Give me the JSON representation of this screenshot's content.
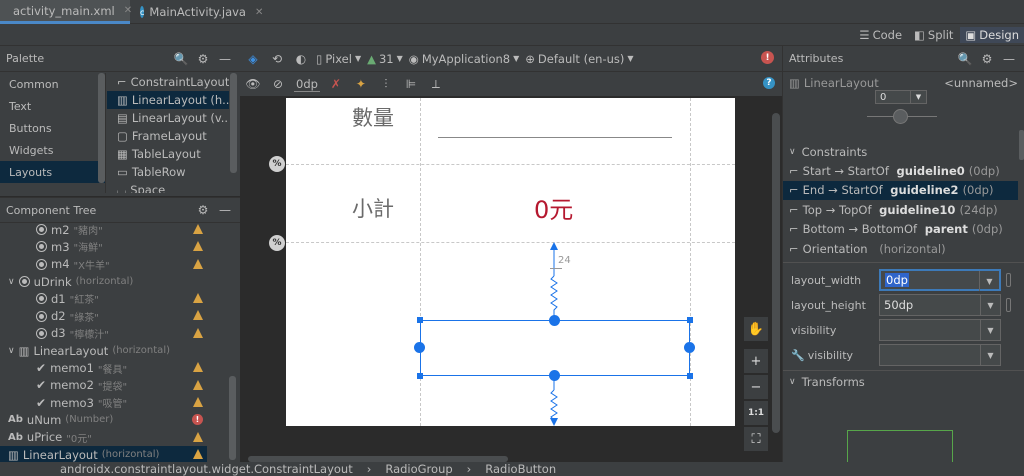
{
  "tabs": [
    {
      "label": "activity_main.xml",
      "active": true
    },
    {
      "label": "MainActivity.java",
      "active": false
    }
  ],
  "mode_buttons": {
    "code": "Code",
    "split": "Split",
    "design": "Design"
  },
  "palette": {
    "title": "Palette",
    "categories": [
      "Common",
      "Text",
      "Buttons",
      "Widgets",
      "Layouts"
    ],
    "selected_category": "Layouts",
    "items": [
      "ConstraintLayout",
      "LinearLayout (h...",
      "LinearLayout (v...",
      "FrameLayout",
      "TableLayout",
      "TableRow",
      "Space"
    ]
  },
  "toolbar": {
    "device": "Pixel",
    "api": "31",
    "app": "MyApplication8",
    "locale": "Default (en-us)",
    "margin": "0dp"
  },
  "component_tree": {
    "title": "Component Tree",
    "rows": [
      {
        "icon": "radio",
        "name": "m2",
        "sub": "\"豬肉\"",
        "indent": 1,
        "status": "warn"
      },
      {
        "icon": "radio",
        "name": "m3",
        "sub": "\"海鮮\"",
        "indent": 1,
        "status": "warn"
      },
      {
        "icon": "radio",
        "name": "m4",
        "sub": "\"X牛羊\"",
        "indent": 1,
        "status": "warn"
      },
      {
        "icon": "radio",
        "name": "uDrink",
        "sub": "(horizontal)",
        "indent": 0,
        "caret": "v",
        "status": ""
      },
      {
        "icon": "radio",
        "name": "d1",
        "sub": "\"紅茶\"",
        "indent": 1,
        "status": "warn"
      },
      {
        "icon": "radio",
        "name": "d2",
        "sub": "\"綠茶\"",
        "indent": 1,
        "status": "warn"
      },
      {
        "icon": "radio",
        "name": "d3",
        "sub": "\"檸檬汁\"",
        "indent": 1,
        "status": "warn"
      },
      {
        "icon": "layout",
        "name": "LinearLayout",
        "sub": "(horizontal)",
        "indent": 0,
        "caret": "v",
        "status": ""
      },
      {
        "icon": "check",
        "name": "memo1",
        "sub": "\"餐具\"",
        "indent": 1,
        "status": "warn"
      },
      {
        "icon": "check",
        "name": "memo2",
        "sub": "\"提袋\"",
        "indent": 1,
        "status": "warn"
      },
      {
        "icon": "check",
        "name": "memo3",
        "sub": "\"吸管\"",
        "indent": 1,
        "status": "warn"
      },
      {
        "icon": "ab",
        "name": "uNum",
        "sub": "(Number)",
        "indent": 0,
        "status": "err"
      },
      {
        "icon": "ab",
        "name": "uPrice",
        "sub": "\"0元\"",
        "indent": 0,
        "status": "warn"
      },
      {
        "icon": "layout",
        "name": "LinearLayout",
        "sub": "(horizontal)",
        "indent": 0,
        "status": "warn",
        "selected": true
      }
    ]
  },
  "design": {
    "qty_label": "數量",
    "subtotal_label": "小計",
    "subtotal_value": "0元",
    "margin_badge": "24",
    "guideline_badge": "%"
  },
  "attributes": {
    "title": "Attributes",
    "component": "LinearLayout",
    "id": "<unnamed>",
    "spinner_value": "0",
    "constraints_title": "Constraints",
    "constraints": [
      {
        "text": "Start → StartOf ",
        "bold": "guideline0",
        "extra": " (0dp)"
      },
      {
        "text": "End → StartOf ",
        "bold": "guideline2",
        "extra": " (0dp)",
        "selected": true
      },
      {
        "text": "Top → TopOf ",
        "bold": "guideline10",
        "extra": " (24dp)"
      },
      {
        "text": "Bottom → BottomOf ",
        "bold": "parent",
        "extra": " (0dp)"
      },
      {
        "text": "Orientation ",
        "bold": "",
        "extra": " (horizontal)"
      }
    ],
    "layout_width_label": "layout_width",
    "layout_width_value": "0dp",
    "layout_height_label": "layout_height",
    "layout_height_value": "50dp",
    "visibility_label": "visibility",
    "visibility2_label": "visibility",
    "transforms_title": "Transforms"
  },
  "statusbar": {
    "crumbs": [
      "androidx.constraintlayout.widget.ConstraintLayout",
      "RadioGroup",
      "RadioButton"
    ]
  },
  "colors": {
    "accent_blue": "#1a73e8",
    "subtotal_red": "#b5182f",
    "selection_bg": "#0d293e"
  }
}
